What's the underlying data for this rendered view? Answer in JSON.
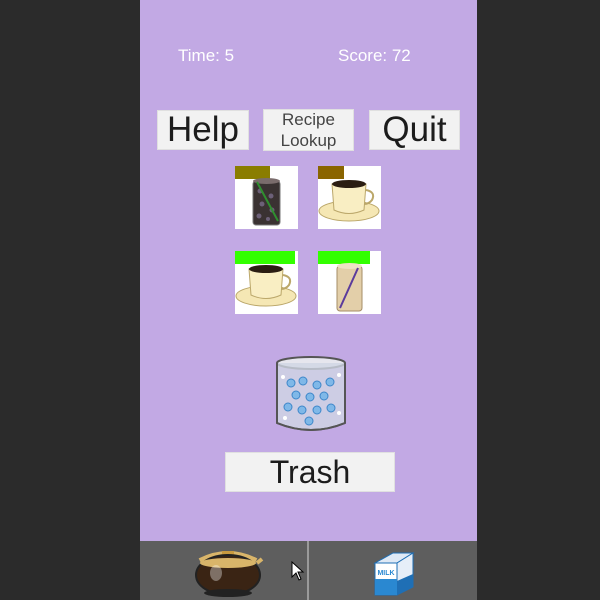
{
  "hud": {
    "time_label": "Time: 5",
    "score_label": "Score: 72"
  },
  "buttons": {
    "help": "Help",
    "recipe_line1": "Recipe",
    "recipe_line2": "Lookup",
    "quit": "Quit",
    "trash": "Trash"
  },
  "orders": [
    {
      "drink": "iced-coffee-glass-icon",
      "timer_fraction": 0.55,
      "timer_color": "#8a7d00"
    },
    {
      "drink": "coffee-cup-saucer-icon",
      "timer_fraction": 0.42,
      "timer_color": "#8a6500"
    },
    {
      "drink": "coffee-cup-saucer-icon",
      "timer_fraction": 0.95,
      "timer_color": "#33ff00"
    },
    {
      "drink": "latte-glass-icon",
      "timer_fraction": 0.82,
      "timer_color": "#33ff00"
    }
  ],
  "station": {
    "icon": "ice-glass-icon"
  },
  "bottom_bar": {
    "left_icon": "coffee-pot-icon",
    "right_icon": "milk-carton-icon",
    "milk_text": "MILK"
  },
  "colors": {
    "background": "#c2a9e4",
    "button": "#f2f2f2",
    "bottom_bar": "#5e5e5e"
  }
}
